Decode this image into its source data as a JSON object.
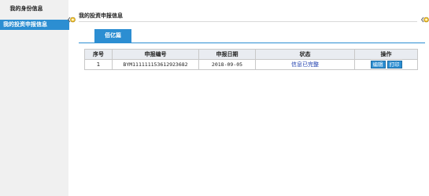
{
  "sidebar": {
    "items": [
      {
        "label": "我的身份信息"
      },
      {
        "label": "我的投资申报信息"
      }
    ]
  },
  "main": {
    "title": "我的投资申报信息",
    "tab": "佰亿篇",
    "table": {
      "headers": [
        "序号",
        "申报编号",
        "申报日期",
        "状态",
        "操作"
      ],
      "rows": [
        {
          "index": "1",
          "code": "BYM111111153612923682",
          "date": "2018-09-05",
          "status": "信息已完整",
          "actions": [
            "编辑",
            "打印"
          ]
        }
      ]
    }
  },
  "colors": {
    "accent": "#2c8ed2",
    "sidebar_bg": "#f0f0f0",
    "header_bg": "#e9ecf1",
    "link": "#1f3fae"
  }
}
